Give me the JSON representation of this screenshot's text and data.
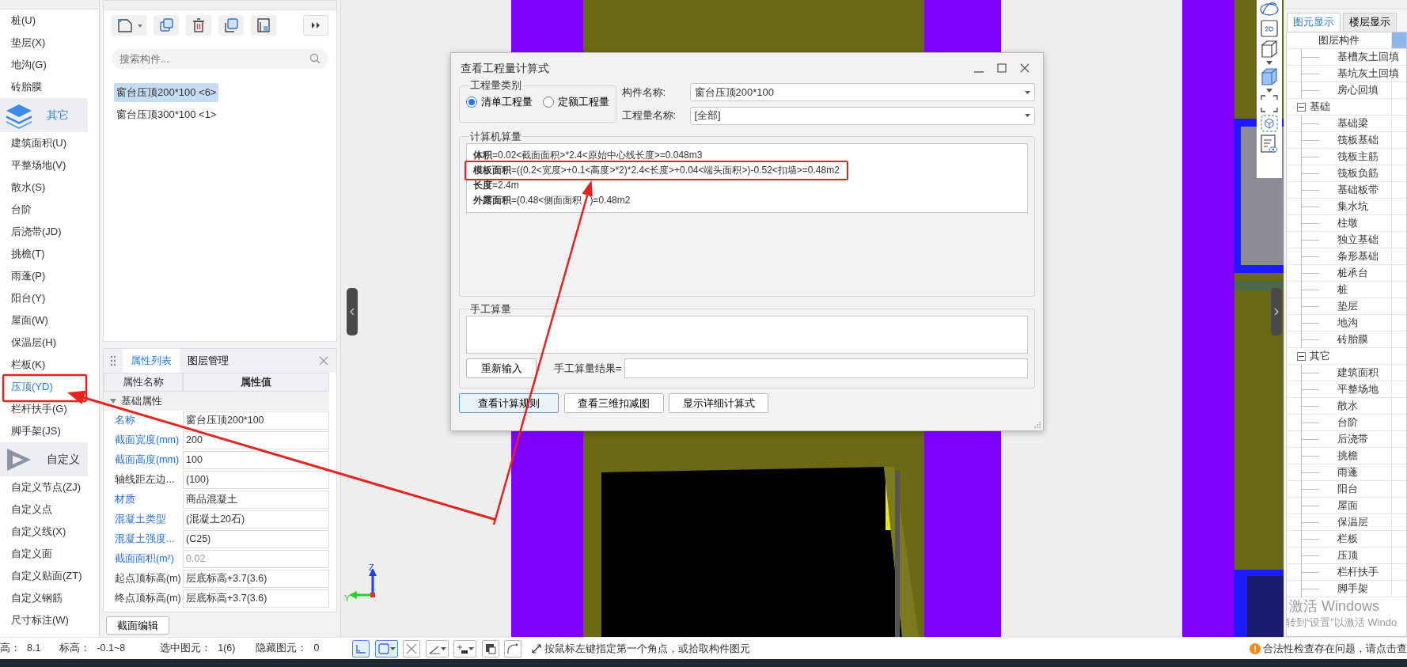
{
  "nav_panel": {
    "items": [
      {
        "kind": "item",
        "label": "桩(U)",
        "selected": false
      },
      {
        "kind": "item",
        "label": "垫层(X)",
        "selected": false
      },
      {
        "kind": "item",
        "label": "地沟(G)",
        "selected": false
      },
      {
        "kind": "item",
        "label": "砖胎膜",
        "selected": false
      },
      {
        "kind": "group",
        "label": "其它",
        "selected": true
      },
      {
        "kind": "item",
        "label": "建筑面积(U)",
        "selected": false
      },
      {
        "kind": "item",
        "label": "平整场地(V)",
        "selected": false
      },
      {
        "kind": "item",
        "label": "散水(S)",
        "selected": false
      },
      {
        "kind": "item",
        "label": "台阶",
        "selected": false
      },
      {
        "kind": "item",
        "label": "后浇带(JD)",
        "selected": false
      },
      {
        "kind": "item",
        "label": "挑檐(T)",
        "selected": false
      },
      {
        "kind": "item",
        "label": "雨蓬(P)",
        "selected": false
      },
      {
        "kind": "item",
        "label": "阳台(Y)",
        "selected": false
      },
      {
        "kind": "item",
        "label": "屋面(W)",
        "selected": false
      },
      {
        "kind": "item",
        "label": "保温层(H)",
        "selected": false
      },
      {
        "kind": "item",
        "label": "栏板(K)",
        "selected": false
      },
      {
        "kind": "item",
        "label": "压顶(YD)",
        "selected": true
      },
      {
        "kind": "item",
        "label": "栏杆扶手(G)",
        "selected": false
      },
      {
        "kind": "item",
        "label": "脚手架(JS)",
        "selected": false
      },
      {
        "kind": "group",
        "label": "自定义",
        "selected": false
      },
      {
        "kind": "item",
        "label": "自定义节点(ZJ)",
        "selected": false
      },
      {
        "kind": "item",
        "label": "自定义点",
        "selected": false
      },
      {
        "kind": "item",
        "label": "自定义线(X)",
        "selected": false
      },
      {
        "kind": "item",
        "label": "自定义面",
        "selected": false
      },
      {
        "kind": "item",
        "label": "自定义贴面(ZT)",
        "selected": false
      },
      {
        "kind": "item",
        "label": "自定义钢筋",
        "selected": false
      },
      {
        "kind": "item",
        "label": "尺寸标注(W)",
        "selected": false
      }
    ]
  },
  "component_list": {
    "search": {
      "placeholder": "搜索构件..."
    },
    "items": [
      {
        "label": "窗台压顶200*100 <6>",
        "selected": true
      },
      {
        "label": "窗台压顶300*100 <1>",
        "selected": false
      }
    ]
  },
  "properties_panel": {
    "tabs": [
      {
        "label": "属性列表",
        "selected": true
      },
      {
        "label": "图层管理",
        "selected": false
      }
    ],
    "columns": [
      "属性名称",
      "属性值"
    ],
    "group": {
      "label": "基础属性",
      "expanded": true
    },
    "rows": [
      {
        "name": "名称",
        "value": "窗台压顶200*100",
        "public": true,
        "readonly": false
      },
      {
        "name": "截面宽度(mm)",
        "value": "200",
        "public": true,
        "readonly": false
      },
      {
        "name": "截面高度(mm)",
        "value": "100",
        "public": true,
        "readonly": false
      },
      {
        "name": "轴线距左边...",
        "value": "(100)",
        "public": false,
        "readonly": false
      },
      {
        "name": "材质",
        "value": "商品混凝土",
        "public": true,
        "readonly": false
      },
      {
        "name": "混凝土类型",
        "value": "(混凝土20石)",
        "public": true,
        "readonly": false
      },
      {
        "name": "混凝土强度...",
        "value": "(C25)",
        "public": true,
        "readonly": false
      },
      {
        "name": "截面面积(m²)",
        "value": "0.02",
        "public": true,
        "readonly": true
      },
      {
        "name": "起点顶标高(m)",
        "value": "层底标高+3.7(3.6)",
        "public": false,
        "readonly": false
      },
      {
        "name": "终点顶标高(m)",
        "value": "层底标高+3.7(3.6)",
        "public": false,
        "readonly": false
      }
    ],
    "button": "截面编辑"
  },
  "canvas": {
    "axis": {
      "z": "Z",
      "y": "Y"
    }
  },
  "dialog": {
    "title": "查看工程量计算式",
    "category": {
      "legend": "工程量类别",
      "options": [
        {
          "label": "清单工程量",
          "selected": true
        },
        {
          "label": "定额工程量",
          "selected": false
        }
      ]
    },
    "fields": [
      {
        "label": "构件名称:",
        "value": "窗台压顶200*100"
      },
      {
        "label": "工程量名称:",
        "value": "[全部]"
      }
    ],
    "computed": {
      "legend": "计算机算量",
      "lines": [
        [
          "**体积**=0.02<截面面积>*2.4<原始中心线长度>=0.048m3"
        ],
        [
          "**模板面积**=((0.2<宽度>+0.1<高度>*2)*2.4<长度>+0.04<端头面积>)-0.52<扣墙>=0.48m2"
        ],
        [
          "**长度**=2.4m"
        ],
        [
          "**外露面积**=(0.48<侧面面积",
          ")=0.48m2"
        ]
      ]
    },
    "manual": {
      "legend": "手工算量",
      "reset_button": "重新输入",
      "result_label": "手工算量结果="
    },
    "buttons": [
      {
        "label": "查看计算规则",
        "focused": true
      },
      {
        "label": "查看三维扣减图",
        "focused": false
      },
      {
        "label": "显示详细计算式",
        "focused": false
      }
    ]
  },
  "display_panel": {
    "tabs": [
      {
        "label": "图元显示",
        "selected": true
      },
      {
        "label": "楼层显示",
        "selected": false
      }
    ],
    "column": "图层构件",
    "tree": [
      {
        "children": [
          {
            "label": "基槽灰土回填"
          },
          {
            "label": "基坑灰土回填"
          },
          {
            "label": "房心回填"
          }
        ]
      },
      {
        "label": "基础",
        "expanded": true,
        "children": [
          {
            "label": "基础梁"
          },
          {
            "label": "筏板基础"
          },
          {
            "label": "筏板主筋"
          },
          {
            "label": "筏板负筋"
          },
          {
            "label": "基础板带"
          },
          {
            "label": "集水坑"
          },
          {
            "label": "柱墩"
          },
          {
            "label": "独立基础"
          },
          {
            "label": "条形基础"
          },
          {
            "label": "桩承台"
          },
          {
            "label": "桩"
          },
          {
            "label": "垫层"
          },
          {
            "label": "地沟"
          },
          {
            "label": "砖胎膜"
          }
        ]
      },
      {
        "label": "其它",
        "expanded": true,
        "children": [
          {
            "label": "建筑面积"
          },
          {
            "label": "平整场地"
          },
          {
            "label": "散水"
          },
          {
            "label": "台阶"
          },
          {
            "label": "后浇带"
          },
          {
            "label": "挑檐"
          },
          {
            "label": "雨蓬"
          },
          {
            "label": "阳台"
          },
          {
            "label": "屋面"
          },
          {
            "label": "保温层"
          },
          {
            "label": "栏板"
          },
          {
            "label": "压顶"
          },
          {
            "label": "栏杆扶手"
          },
          {
            "label": "脚手架"
          }
        ]
      }
    ]
  },
  "status_bar": {
    "fields": [
      {
        "label": "高：",
        "value": "8.1"
      },
      {
        "label": "标高：",
        "value": "-0.1~8"
      },
      {
        "label": "选中图元：",
        "value": "1(6)"
      },
      {
        "label": "隐藏图元：",
        "value": "0"
      }
    ],
    "hint": "按鼠标左键指定第一个角点，或拾取构件图元",
    "warning": "合法性检查存在问题，请点击查"
  },
  "system_notice": {
    "title": "激活 Windows",
    "text": "转到“设置”以激活 Windo"
  }
}
